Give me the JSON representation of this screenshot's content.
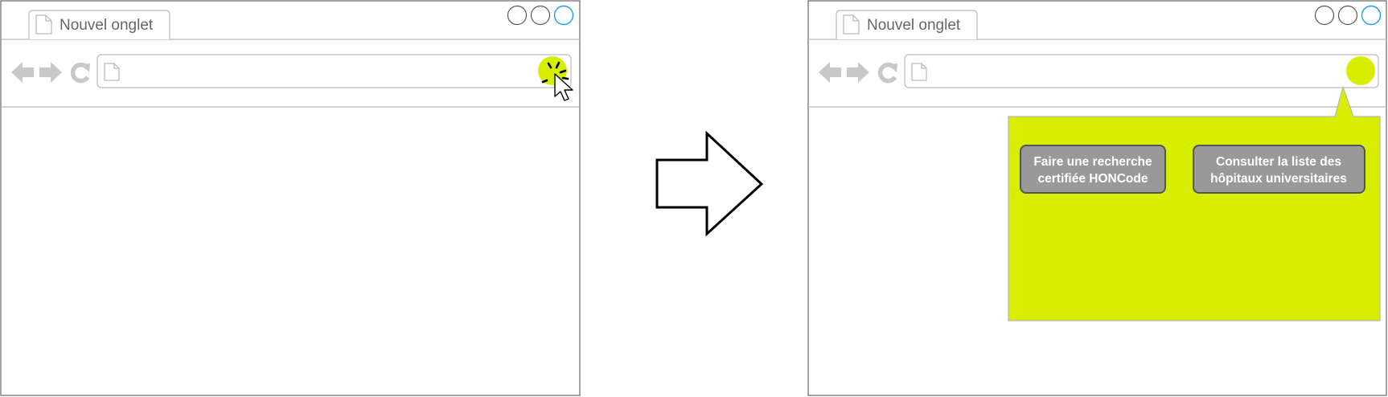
{
  "before": {
    "tab_label": "Nouvel onglet"
  },
  "after": {
    "tab_label": "Nouvel onglet",
    "popup": {
      "buttons": [
        {
          "lines": [
            "Faire une recherche",
            "certifiée HONCode"
          ]
        },
        {
          "lines": [
            "Consulter la liste des",
            "hôpitaux universitaires"
          ]
        }
      ]
    }
  },
  "colors": {
    "accent": "#d7ee00",
    "button_fill": "#999999",
    "chrome_gray": "#c8c8c8",
    "window_active": "#1ba1e2"
  },
  "icons": [
    "back-arrow-icon",
    "forward-arrow-icon",
    "reload-icon",
    "page-icon",
    "extension-icon",
    "cursor-icon",
    "click-burst-icon",
    "transition-arrow-icon"
  ]
}
